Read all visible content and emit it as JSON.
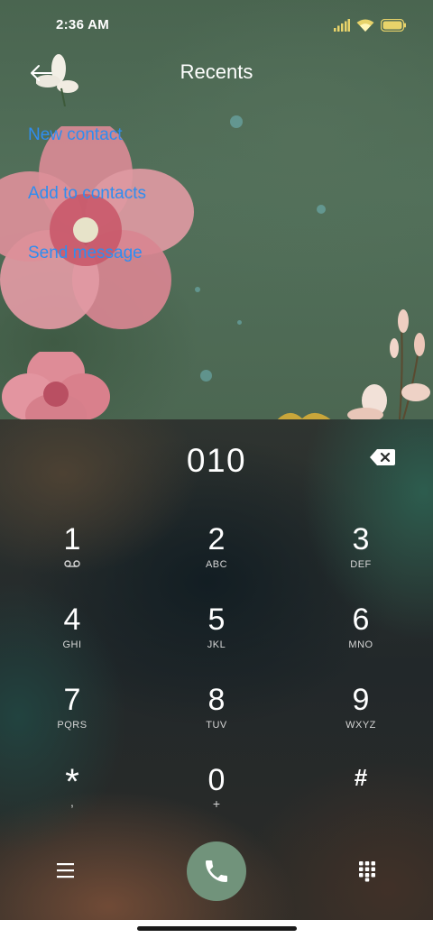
{
  "status_bar": {
    "time": "2:36 AM",
    "icons": [
      "signal-icon",
      "wifi-icon",
      "battery-icon"
    ]
  },
  "header": {
    "title": "Recents",
    "back_icon": "arrow-left-icon"
  },
  "actions": {
    "new_contact": "New contact",
    "add_to_contacts": "Add to contacts",
    "send_message": "Send message"
  },
  "dialer": {
    "number": "010",
    "backspace_icon": "backspace-icon",
    "keys": [
      {
        "digit": "1",
        "sub": "",
        "sub_icon": "voicemail-icon"
      },
      {
        "digit": "2",
        "sub": "ABC"
      },
      {
        "digit": "3",
        "sub": "DEF"
      },
      {
        "digit": "4",
        "sub": "GHI"
      },
      {
        "digit": "5",
        "sub": "JKL"
      },
      {
        "digit": "6",
        "sub": "MNO"
      },
      {
        "digit": "7",
        "sub": "PQRS"
      },
      {
        "digit": "8",
        "sub": "TUV"
      },
      {
        "digit": "9",
        "sub": "WXYZ"
      },
      {
        "digit": "*",
        "sub": ","
      },
      {
        "digit": "0",
        "sub": "+"
      },
      {
        "digit": "#",
        "sub": ""
      }
    ]
  },
  "bottom_bar": {
    "menu_icon": "menu-icon",
    "call_icon": "phone-icon",
    "keypad_icon": "keypad-icon"
  },
  "colors": {
    "link": "#2f8df0",
    "call_button": "#71937b",
    "wallpaper": "#4c6752"
  }
}
